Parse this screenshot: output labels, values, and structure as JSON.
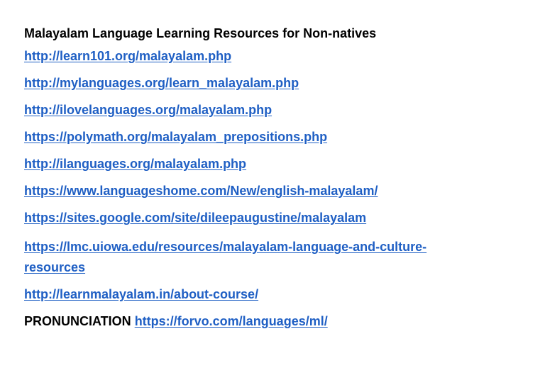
{
  "document": {
    "title": "Malayalam Language Learning Resources for Non-natives",
    "links": [
      "http://learn101.org/malayalam.php",
      "http://mylanguages.org/learn_malayalam.php",
      "http://ilovelanguages.org/malayalam.php",
      "https://polymath.org/malayalam_prepositions.php",
      "http://ilanguages.org/malayalam.php",
      "https://www.languageshome.com/New/english-malayalam/",
      "https://sites.google.com/site/dileepaugustine/malayalam",
      "https://lmc.uiowa.edu/resources/malayalam-language-and-culture-resources",
      "http://learnmalayalam.in/about-course/"
    ],
    "pronunciation": {
      "label": "PRONUNCIATION",
      "link": "https://forvo.com/languages/ml/"
    }
  },
  "colors": {
    "link": "#1f5fc4",
    "text": "#000000",
    "background": "#ffffff"
  }
}
